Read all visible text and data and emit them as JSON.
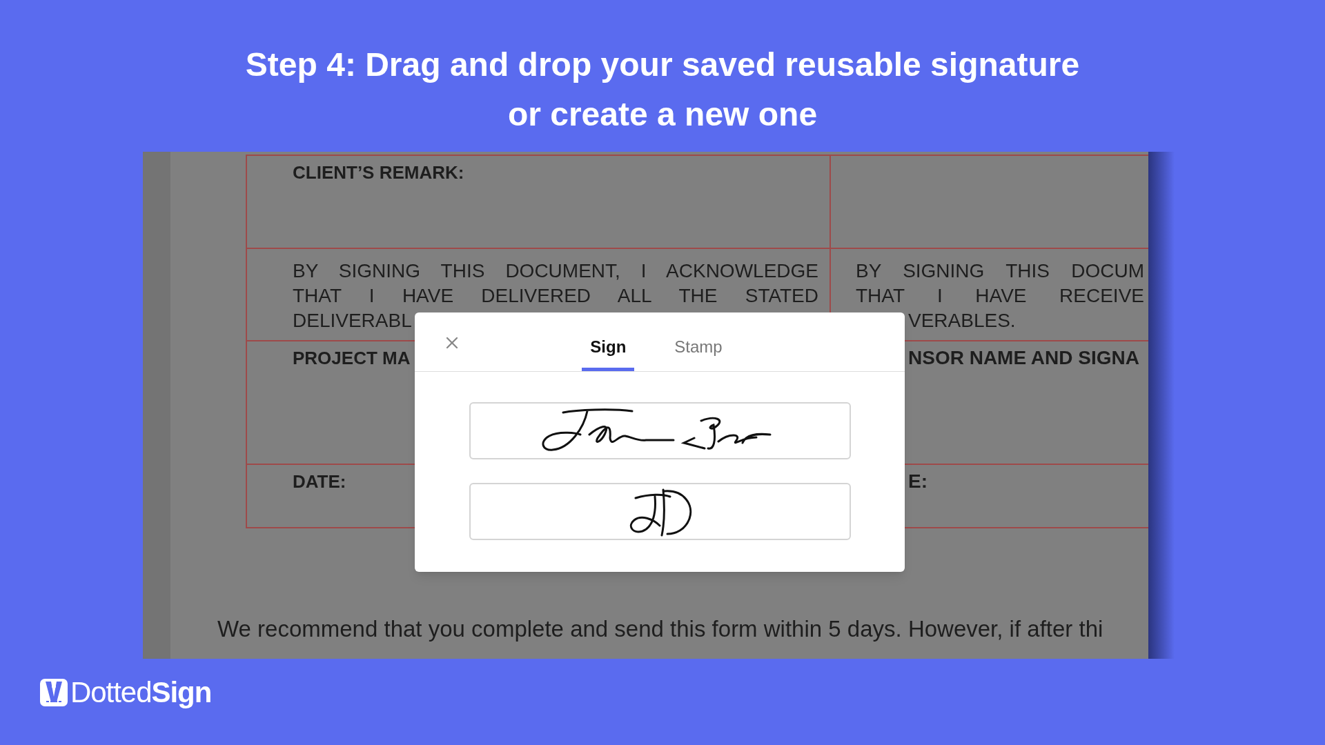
{
  "heading": {
    "lines": [
      "Step 4: Drag and drop your saved reusable signature",
      "or create a new one"
    ]
  },
  "document": {
    "rows": [
      {
        "kind": "label",
        "left": [
          "CLIENT’S REMARK:"
        ]
      },
      {
        "kind": "statement",
        "left": [
          "BY SIGNING THIS DOCUMENT, I ACKNOWLEDGE",
          "THAT I HAVE DELIVERED ALL THE STATED",
          "DELIVERABL"
        ],
        "right": [
          "BY SIGNING THIS DOCUM",
          "THAT I HAVE RECEIVE",
          "VERABLES."
        ]
      },
      {
        "kind": "label",
        "left": [
          "PROJECT MA"
        ],
        "right": [
          "NSOR NAME AND SIGNA"
        ]
      },
      {
        "kind": "label",
        "left": [
          "DATE:"
        ],
        "right": [
          "E:"
        ]
      }
    ],
    "note": "We recommend that you complete and send this form within 5 days. However, if after thi"
  },
  "dialog": {
    "tabs": [
      {
        "label": "Sign",
        "selected": true
      },
      {
        "label": "Stamp",
        "selected": false
      }
    ],
    "signatures": [
      {
        "kind": "full"
      },
      {
        "kind": "initials"
      }
    ]
  },
  "logo": {
    "text": "Dotted**Sign**"
  }
}
